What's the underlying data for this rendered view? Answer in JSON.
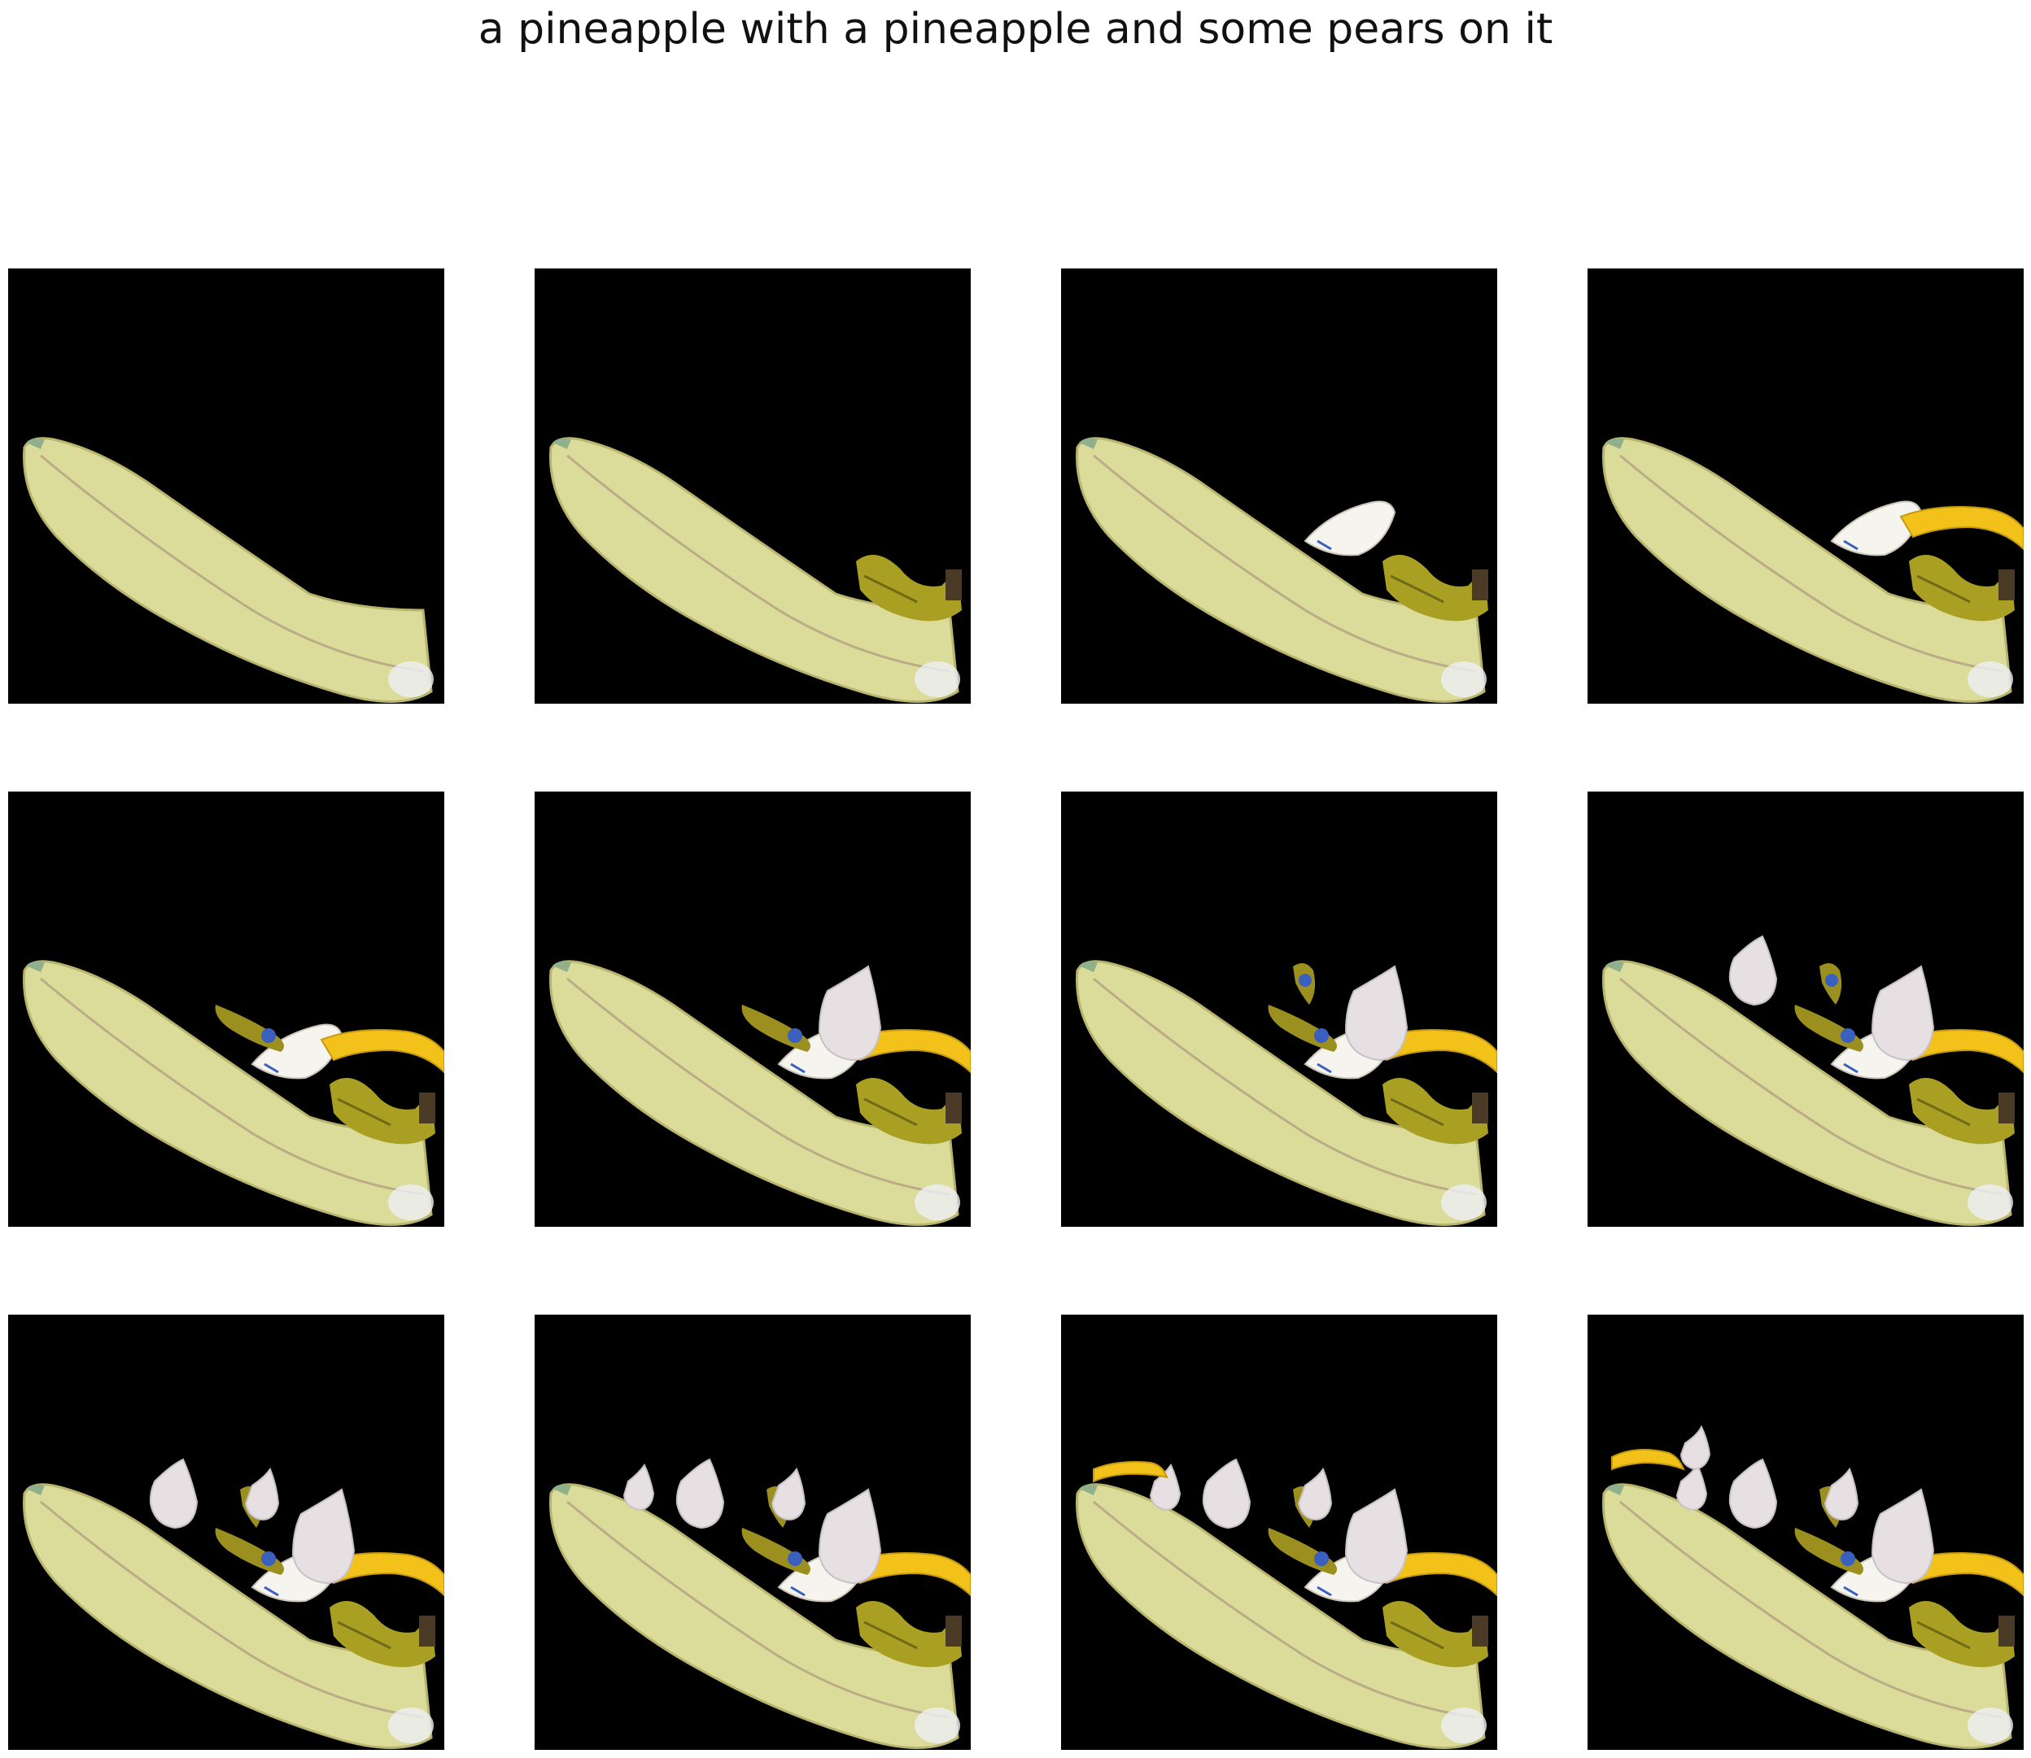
{
  "figure": {
    "title": "a pineapple with a pineapple and some pears on it"
  },
  "colors": {
    "background": "#000000",
    "big_banana": "#dcdc9a",
    "banana_yellow": "#f2c21a",
    "green_banana": "#a99f22",
    "white_piece": "#f6f4ee",
    "pear_white": "#e6e0e2",
    "sticker_blue": "#3a5fbf",
    "dark_stem": "#4b3a26"
  },
  "panels": [
    {
      "step": 1,
      "objects": [
        "big-banana"
      ]
    },
    {
      "step": 2,
      "objects": [
        "big-banana",
        "green-bunch"
      ]
    },
    {
      "step": 3,
      "objects": [
        "big-banana",
        "green-bunch",
        "white-piece"
      ]
    },
    {
      "step": 4,
      "objects": [
        "big-banana",
        "green-bunch",
        "white-piece",
        "yellow-banana"
      ]
    },
    {
      "step": 5,
      "objects": [
        "big-banana",
        "green-bunch",
        "white-piece",
        "yellow-banana",
        "sticker-banana"
      ]
    },
    {
      "step": 6,
      "objects": [
        "big-banana",
        "green-bunch",
        "white-piece",
        "yellow-banana",
        "sticker-banana",
        "pear-a"
      ]
    },
    {
      "step": 7,
      "objects": [
        "big-banana",
        "green-bunch",
        "white-piece",
        "yellow-banana",
        "sticker-banana",
        "pear-a",
        "sticker-banana-2"
      ]
    },
    {
      "step": 8,
      "objects": [
        "big-banana",
        "green-bunch",
        "white-piece",
        "yellow-banana",
        "sticker-banana",
        "pear-a",
        "sticker-banana-2",
        "pear-b"
      ]
    },
    {
      "step": 9,
      "objects": [
        "big-banana",
        "green-bunch",
        "white-piece",
        "yellow-banana",
        "sticker-banana",
        "pear-a",
        "sticker-banana-2",
        "pear-b",
        "pear-c"
      ]
    },
    {
      "step": 10,
      "objects": [
        "big-banana",
        "green-bunch",
        "white-piece",
        "yellow-banana",
        "sticker-banana",
        "pear-a",
        "sticker-banana-2",
        "pear-b",
        "pear-c",
        "pear-d"
      ]
    },
    {
      "step": 11,
      "objects": [
        "big-banana",
        "green-bunch",
        "white-piece",
        "yellow-banana",
        "sticker-banana",
        "pear-a",
        "sticker-banana-2",
        "pear-b",
        "pear-c",
        "pear-d",
        "small-banana"
      ]
    },
    {
      "step": 12,
      "objects": [
        "big-banana",
        "green-bunch",
        "white-piece",
        "yellow-banana",
        "sticker-banana",
        "pear-a",
        "sticker-banana-2",
        "pear-b",
        "pear-c",
        "pear-d",
        "small-banana-2",
        "pear-e"
      ]
    }
  ]
}
